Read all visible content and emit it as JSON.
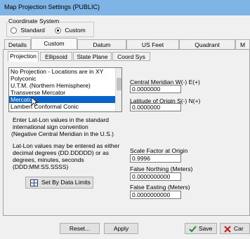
{
  "window": {
    "title": "Map Projection Settings (PUBLIC)"
  },
  "coordinate_system": {
    "label": "Coordinate System",
    "options": [
      {
        "label": "Standard",
        "selected": false
      },
      {
        "label": "Custom",
        "selected": true
      }
    ]
  },
  "tabs": [
    "Details",
    "Custom",
    "Datum",
    "US Feet",
    "Quadrant",
    "M"
  ],
  "active_tab": "Custom",
  "subtabs": [
    "Projection",
    "Ellipsoid",
    "State Plane",
    "Coord Sys"
  ],
  "active_subtab": "Projection",
  "projection_list": {
    "items": [
      "No Projection - Locations are in XY",
      "Polyconic",
      "U.T.M. (Northern Hemisphere)",
      "Transverse Mercator",
      "Mercator",
      "Lambert Conformal Conic"
    ],
    "selected": "Mercator"
  },
  "help": {
    "line1": "Enter Lat-Lon values in the standard",
    "line2": "international sign convention",
    "line3": "(Negative Central Meridian in the U.S.)",
    "line4": "Lat-Lon values may be entered as either",
    "line5": "decimal degrees (DD.DDDDD) or as",
    "line6": "degrees, minutes, seconds",
    "line7": "(DDD:MM:SS.SSSS)"
  },
  "set_by_data_limits": "Set By Data Limits",
  "fields": {
    "central_meridian": {
      "label": "Central Meridian W(-) E(+)",
      "value": "0.0000000"
    },
    "latitude_origin": {
      "label": "Latitude of Origin S(-) N(+)",
      "value": "0.0000000"
    },
    "scale_factor": {
      "label": "Scale Factor at Origin",
      "value": "0.9996"
    },
    "false_northing": {
      "label": "False Northing  (Meters)",
      "value": "0.0000000000"
    },
    "false_easting": {
      "label": "False Easting  (Meters)",
      "value": "0.0000000000"
    }
  },
  "buttons": {
    "reset": "Reset...",
    "apply": "Apply",
    "save": "Save",
    "cancel": "Car"
  },
  "colors": {
    "titlebar": "#7fb4e6",
    "selection": "#0a64c8",
    "save_check": "#1e8f1e",
    "cancel_x": "#d01818"
  }
}
